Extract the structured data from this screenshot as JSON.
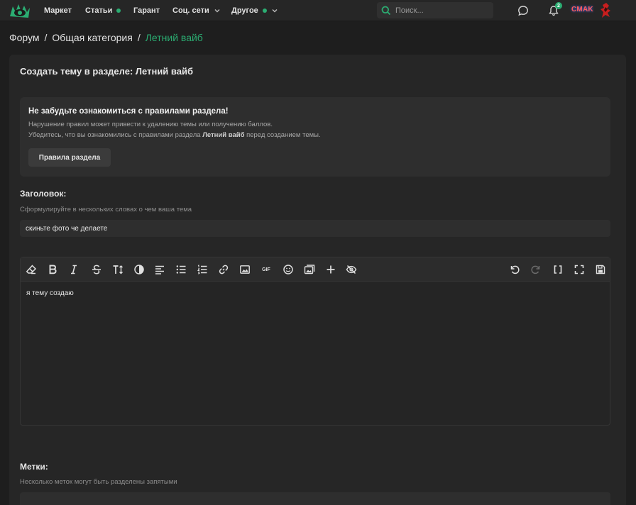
{
  "nav": {
    "items": [
      {
        "label": "Маркет"
      },
      {
        "label": "Статьи"
      },
      {
        "label": "Гарант"
      },
      {
        "label": "Соц. сети"
      },
      {
        "label": "Другое"
      }
    ],
    "search_placeholder": "Поиск...",
    "notification_count": "2",
    "username": "CMAK"
  },
  "breadcrumb": {
    "items": [
      "Форум",
      "Общая категория"
    ],
    "current": "Летний вайб",
    "separator": "/"
  },
  "page": {
    "title": "Создать тему в разделе: Летний вайб"
  },
  "notice": {
    "title": "Не забудьте ознакомиться с правилами раздела!",
    "line1": "Нарушение правил может привести к удалению темы или получению баллов.",
    "line2_prefix": "Убедитесь, что вы ознакомились с правилами раздела ",
    "line2_bold": "Летний вайб",
    "line2_suffix": " перед созданием темы.",
    "button": "Правила раздела"
  },
  "form": {
    "title_label": "Заголовок:",
    "title_hint": "Сформулируйте в нескольких словах о чем ваша тема",
    "title_value": "скиньте фото че делаете",
    "editor_text": "я тему создаю",
    "tags_label": "Метки:",
    "tags_hint": "Несколько меток могут быть разделены запятыми",
    "toolbar_gif": "GIF"
  },
  "colors": {
    "accent": "#2bad72",
    "background": "#1e1e1e",
    "panel": "#262626"
  }
}
